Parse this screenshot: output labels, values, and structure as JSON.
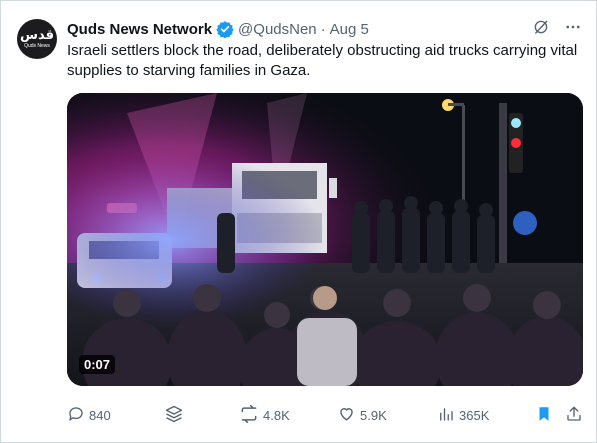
{
  "account": {
    "name": "Quds News Network",
    "handle": "@QudsNen",
    "separator": "·",
    "date": "Aug 5",
    "avatar_logo": "قدس",
    "avatar_sub": "Quds News"
  },
  "tweet": {
    "text": "Israeli settlers block the road, deliberately obstructing aid trucks carrying vital supplies to starving families in Gaza."
  },
  "media": {
    "duration": "0:07"
  },
  "actions": {
    "replies": "840",
    "reposts": "4.8K",
    "likes": "5.9K",
    "views": "365K"
  },
  "colors": {
    "verified": "#1d9bf0",
    "muted": "#536471",
    "bookmark_active": "#1d9bf0"
  },
  "icons": [
    "verified-badge-icon",
    "grok-icon",
    "more-icon",
    "reply-icon",
    "stack-icon",
    "repost-icon",
    "like-icon",
    "views-icon",
    "bookmark-icon",
    "share-icon"
  ]
}
